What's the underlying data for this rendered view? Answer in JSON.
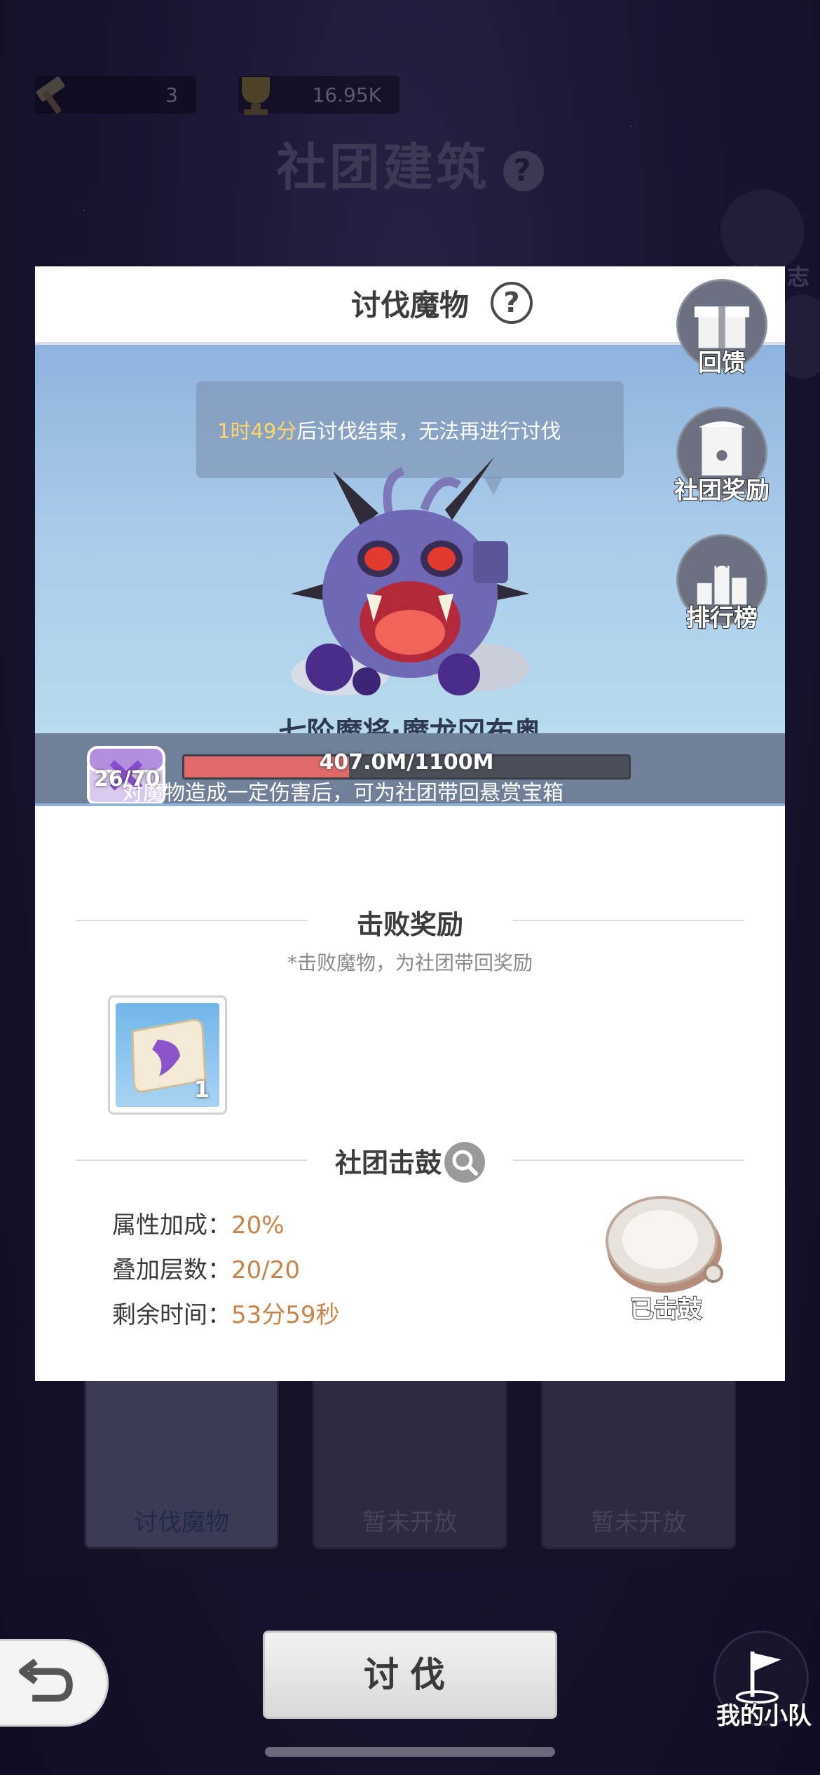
{
  "background": {
    "resources": [
      {
        "icon": "hammer-icon",
        "value": "3"
      },
      {
        "icon": "trophy-icon",
        "value": "16.95K"
      }
    ],
    "title": "社团建筑",
    "help": "?",
    "side_label": "建造日志",
    "cards": [
      "讨伐魔物",
      "暂未开放",
      "暂未开放"
    ]
  },
  "modal": {
    "title": "讨伐魔物",
    "help": "?",
    "bubble": {
      "highlight": "1时49分",
      "rest": "后讨伐结束，无法再进行讨伐"
    },
    "boss_name": "七阶魔将·魔龙冈布奥",
    "hp": {
      "text": "407.0M/1100M",
      "current": 407.0,
      "max": 1100
    },
    "chest_count": "26/70",
    "hp_desc": "对魔物造成一定伤害后，可为社团带回悬赏宝箱",
    "reward": {
      "title": "击败奖励",
      "subtitle": "*击败魔物，为社团带回奖励",
      "item_count": "1"
    },
    "drum": {
      "title": "社团击鼓",
      "stats": [
        {
          "label": "属性加成：",
          "value": "20%"
        },
        {
          "label": "叠加层数：",
          "value": "20/20"
        },
        {
          "label": "剩余时间：",
          "value": "53分59秒"
        }
      ],
      "status": "已击鼓"
    }
  },
  "side_buttons": [
    {
      "icon": "gift-icon",
      "label": "回馈"
    },
    {
      "icon": "club-reward-icon",
      "label": "社团奖励"
    },
    {
      "icon": "ranking-icon",
      "label": "排行榜"
    }
  ],
  "bottom": {
    "attack": "讨伐",
    "team": "我的小队"
  },
  "colors": {
    "highlight": "#ffd66a",
    "value": "#c9844a",
    "hp_fill": "#e06a6a"
  }
}
